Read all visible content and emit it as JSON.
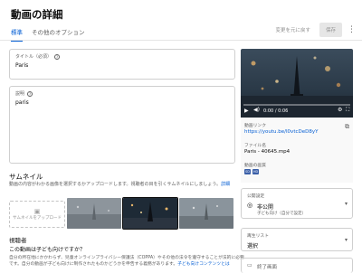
{
  "page": {
    "title": "動画の詳細"
  },
  "tabs": [
    {
      "label": "標準",
      "active": true
    },
    {
      "label": "その他のオプション",
      "active": false
    }
  ],
  "header_actions": {
    "undo_label": "変更を元に戻す",
    "save_label": "保存"
  },
  "title_field": {
    "label": "タイトル（必須）",
    "value": "Paris"
  },
  "description_field": {
    "label": "説明",
    "value": "paris"
  },
  "thumbnail": {
    "heading": "サムネイル",
    "description": "動画の内容がわかる画像を選択するかアップロードします。視聴者の目を引くサムネイルにしましょう。",
    "link": "詳細",
    "upload_label": "サムネイルをアップロード"
  },
  "audience": {
    "heading": "視聴者",
    "question": "この動画は子ども向けですか？",
    "description": "自分の所在地にかかわらず、児童オンラインプライバシー保護法（COPPA）やその他の法令を遵守することが法的に必要です。自分の動画が子ども向けに制作されたものかどうかを申告する義務があります。",
    "link": "子ども向けコンテンツとは"
  },
  "player": {
    "time": "0:00 / 0:06",
    "progress": 0.0
  },
  "video_info": {
    "link_label": "動画リンク",
    "link": "https://youtu.be/I0vtcDeD8yY",
    "file_label": "ファイル名",
    "file_name": "Paris - 40645.mp4",
    "quality_label": "動画の画質",
    "quality_badges": [
      "SD",
      "HD"
    ]
  },
  "visibility": {
    "label": "公開設定",
    "value": "非公開",
    "sub": "子ども向け（自分で設定）"
  },
  "playlist": {
    "label": "再生リスト",
    "value": "選択"
  },
  "end_screen": {
    "label": "終了画面"
  },
  "colors": {
    "accent": "#065fd4",
    "progress": "#ff0000",
    "quality_badge": "#3a5fa8"
  }
}
